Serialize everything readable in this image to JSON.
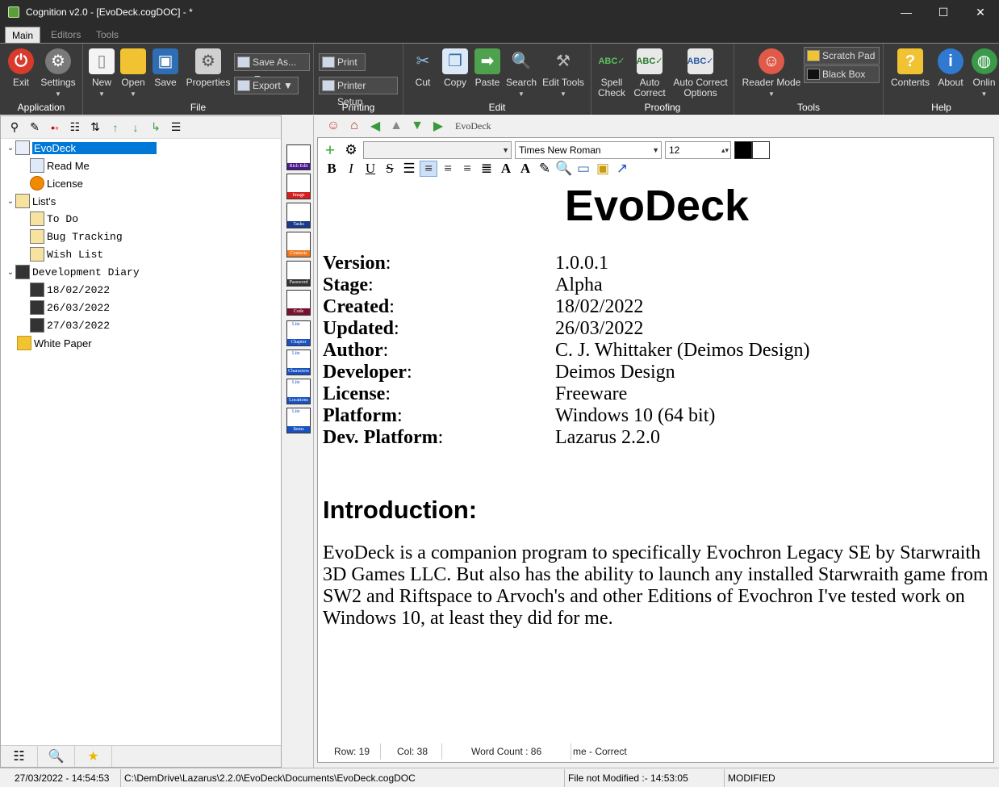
{
  "window": {
    "title": "Cognition v2.0  - [EvoDeck.cogDOC] - *",
    "min": "—",
    "max": "☐",
    "close": "✕"
  },
  "ribbon_tabs": [
    "Main",
    "Editors",
    "Tools"
  ],
  "ribbon": {
    "application": {
      "title": "Application",
      "exit": "Exit",
      "settings": "Settings"
    },
    "file": {
      "title": "File",
      "new": "New",
      "open": "Open",
      "save": "Save",
      "properties": "Properties",
      "save_as": "Save As...",
      "export": "Export"
    },
    "printing": {
      "title": "Printing",
      "print": "Print",
      "printer_setup": "Printer Setup"
    },
    "edit": {
      "title": "Edit",
      "cut": "Cut",
      "copy": "Copy",
      "paste": "Paste",
      "search": "Search",
      "edit_tools": "Edit Tools"
    },
    "proofing": {
      "title": "Proofing",
      "spell_check_1": "Spell",
      "spell_check_2": "Check",
      "auto_correct_1": "Auto",
      "auto_correct_2": "Correct",
      "ac_options_1": "Auto Correct",
      "ac_options_2": "Options"
    },
    "tools": {
      "title": "Tools",
      "reader_mode": "Reader Mode",
      "scratch_pad": "Scratch Pad",
      "black_box": "Black Box"
    },
    "help": {
      "title": "Help",
      "contents": "Contents",
      "about": "About",
      "online": "Onlin"
    }
  },
  "tree": {
    "root": "EvoDeck",
    "read_me": "Read Me",
    "license": "License",
    "lists": "List's",
    "todo": "To Do",
    "bug_tracking": "Bug Tracking",
    "wish_list": "Wish List",
    "dev_diary": "Development Diary",
    "d1": "18/02/2022",
    "d2": "26/03/2022",
    "d3": "27/03/2022",
    "white_paper": "White Paper"
  },
  "templates": [
    "Rich Edit",
    "Image",
    "Tasks",
    "Contacts",
    "Password",
    "Code",
    "Chapter",
    "Characters",
    "Locations",
    "Items"
  ],
  "templates_lite": "Lite",
  "nav": {
    "path": "EvoDeck"
  },
  "format": {
    "font": "Times New Roman",
    "size": "12"
  },
  "doc": {
    "title": "EvoDeck",
    "meta": [
      {
        "k": "Version",
        "v": "1.0.0.1"
      },
      {
        "k": "Stage",
        "v": "Alpha"
      },
      {
        "k": "Created",
        "v": "18/02/2022"
      },
      {
        "k": "Updated",
        "v": "26/03/2022"
      },
      {
        "k": "Author",
        "v": "C. J. Whittaker (Deimos Design)"
      },
      {
        "k": "Developer",
        "v": "Deimos Design"
      },
      {
        "k": "License",
        "v": "Freeware"
      },
      {
        "k": "Platform",
        "v": "Windows 10 (64 bit)"
      },
      {
        "k": "Dev. Platform",
        "v": "Lazarus 2.2.0"
      }
    ],
    "colon": ":",
    "intro_heading": "Introduction:",
    "intro_text": "EvoDeck is a companion program to specifically Evochron Legacy SE by Starwraith 3D Games LLC.  But also has the ability to launch any installed Starwraith game from SW2 and Riftspace to Arvoch's and other Editions of Evochron I've tested work on Windows 10, at least they did for me."
  },
  "editor_status": {
    "row": "Row: 19",
    "col": "Col: 38",
    "words": "Word Count : 86",
    "spell": "me - Correct"
  },
  "status": {
    "datetime": "27/03/2022 - 14:54:53",
    "path": "C:\\DemDrive\\Lazarus\\2.2.0\\EvoDeck\\Documents\\EvoDeck.cogDOC",
    "saved": "File not Modified :- 14:53:05",
    "state": "MODIFIED"
  }
}
